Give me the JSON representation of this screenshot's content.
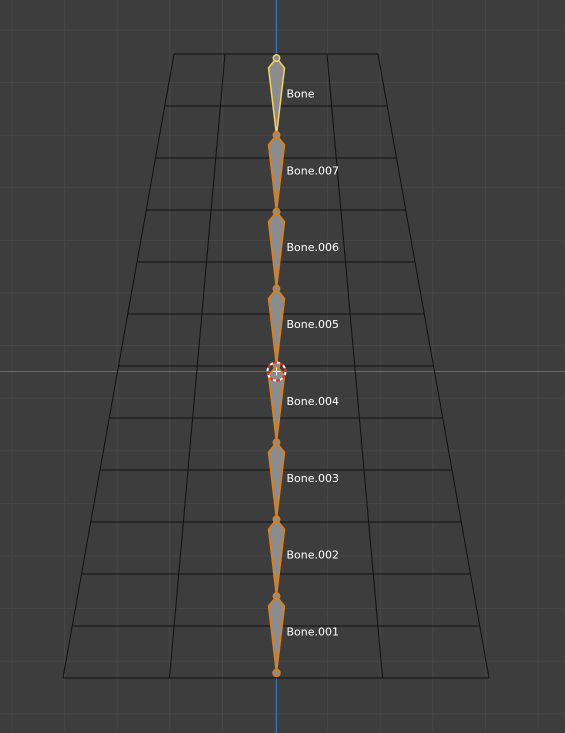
{
  "viewport": {
    "background": "#3d3d3d",
    "grid_color": "#474747",
    "x_axis_color": "#c4463f",
    "y_axis_color": "#3f74c4",
    "mesh_wire_color": "#111111",
    "bone_outline_color": "#e87d0d",
    "bone_fill_color": "#8c8c8c",
    "active_bone_color": "#f4d35e",
    "cursor_icon": "3d-cursor-icon"
  },
  "bones": [
    {
      "name": "Bone",
      "active": true
    },
    {
      "name": "Bone.007",
      "active": false
    },
    {
      "name": "Bone.006",
      "active": false
    },
    {
      "name": "Bone.005",
      "active": false
    },
    {
      "name": "Bone.004",
      "active": false
    },
    {
      "name": "Bone.003",
      "active": false
    },
    {
      "name": "Bone.002",
      "active": false
    },
    {
      "name": "Bone.001",
      "active": false
    }
  ]
}
